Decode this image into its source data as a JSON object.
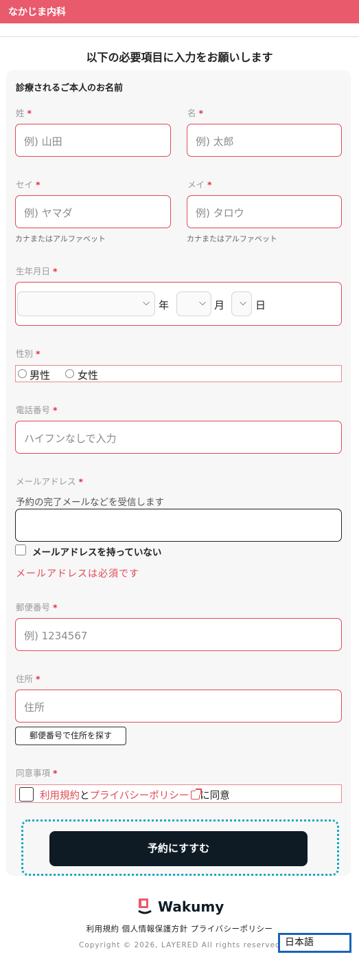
{
  "header": {
    "clinic_name": "なかじま内科"
  },
  "form": {
    "heading": "以下の必要項目に入力をお願いします",
    "section_title": "診療されるご本人のお名前",
    "required_mark": "*",
    "last_name": {
      "label": "姓",
      "placeholder": "例) 山田"
    },
    "first_name": {
      "label": "名",
      "placeholder": "例) 太郎"
    },
    "last_name_kana": {
      "label": "セイ",
      "placeholder": "例) ヤマダ",
      "hint": "カナまたはアルファベット"
    },
    "first_name_kana": {
      "label": "メイ",
      "placeholder": "例) タロウ",
      "hint": "カナまたはアルファベット"
    },
    "birthdate": {
      "label": "生年月日",
      "year_unit": "年",
      "month_unit": "月",
      "day_unit": "日"
    },
    "gender": {
      "label": "性別",
      "options": [
        "男性",
        "女性"
      ]
    },
    "phone": {
      "label": "電話番号",
      "placeholder": "ハイフンなしで入力"
    },
    "email": {
      "label": "メールアドレス",
      "description": "予約の完了メールなどを受信します",
      "no_email_label": "メールアドレスを持っていない",
      "error": "メールアドレスは必須です"
    },
    "postal_code": {
      "label": "郵便番号",
      "placeholder": "例) 1234567"
    },
    "address": {
      "label": "住所",
      "placeholder": "住所",
      "lookup_button": "郵便番号で住所を探す"
    },
    "consent": {
      "label": "同意事項",
      "terms_link": "利用規約",
      "and": "と",
      "privacy_link": "プライバシーポリシー",
      "suffix": "に同意"
    },
    "submit_label": "予約にすすむ"
  },
  "footer": {
    "brand": "Wakumy",
    "links": "利用規約 個人情報保護方針 プライバシーポリシー",
    "copyright": "Copyright © 2026, LAYERED All rights reserved.",
    "language": "日本語"
  },
  "colors": {
    "accent": "#e85a6c",
    "error": "#e04a55",
    "button": "#0e1b25",
    "focus": "#17a8bf"
  },
  "icons": [
    "chevron-down-icon",
    "external-link-icon",
    "wakumy-logo-icon"
  ]
}
